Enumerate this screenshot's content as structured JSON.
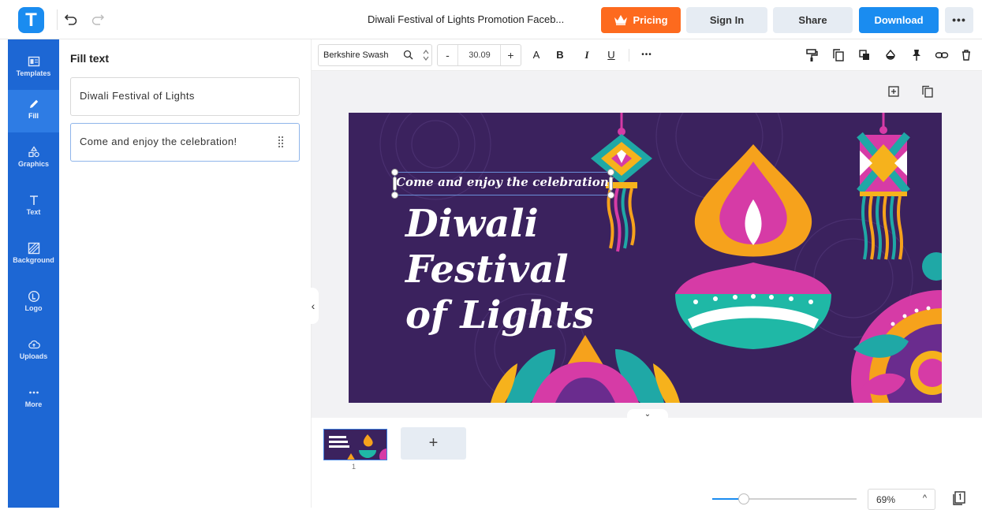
{
  "app": {
    "logo_letter": "T",
    "document_title": "Diwali Festival of Lights Promotion Faceb...",
    "accent_color": "#1a8cf0",
    "pricing_color": "#fd6a1e"
  },
  "topbar": {
    "pricing_label": "Pricing",
    "signin_label": "Sign In",
    "share_label": "Share",
    "download_label": "Download",
    "more_label": "•••",
    "undo_icon": "undo-icon",
    "redo_icon": "redo-icon"
  },
  "rail": {
    "items": [
      {
        "label": "Templates",
        "icon": "templates-icon"
      },
      {
        "label": "Fill",
        "icon": "pencil-icon",
        "active": true
      },
      {
        "label": "Graphics",
        "icon": "shapes-icon"
      },
      {
        "label": "Text",
        "icon": "text-icon"
      },
      {
        "label": "Background",
        "icon": "background-icon"
      },
      {
        "label": "Logo",
        "icon": "logo-icon"
      },
      {
        "label": "Uploads",
        "icon": "cloud-upload-icon"
      },
      {
        "label": "More",
        "icon": "more-icon"
      }
    ]
  },
  "panel": {
    "title": "Fill text",
    "fields": [
      {
        "value": "Diwali Festival of Lights"
      },
      {
        "value": "Come and enjoy the celebration!"
      }
    ]
  },
  "toolbar": {
    "font_family": "Berkshire Swash",
    "font_size": "30.09",
    "minus": "-",
    "plus": "+",
    "text_case": "A",
    "bold": "B",
    "italic": "I",
    "underline": "U",
    "more": "•••"
  },
  "canvas": {
    "tagline": "Come and enjoy the celebration!",
    "headline_line1": "Diwali",
    "headline_line2": "Festival",
    "headline_line3": "of Lights",
    "background_color": "#3b225e"
  },
  "pages": {
    "thumb_number": "1",
    "add_label": "+"
  },
  "zoom": {
    "value": "69%",
    "fraction": 0.22,
    "caret": "^"
  }
}
